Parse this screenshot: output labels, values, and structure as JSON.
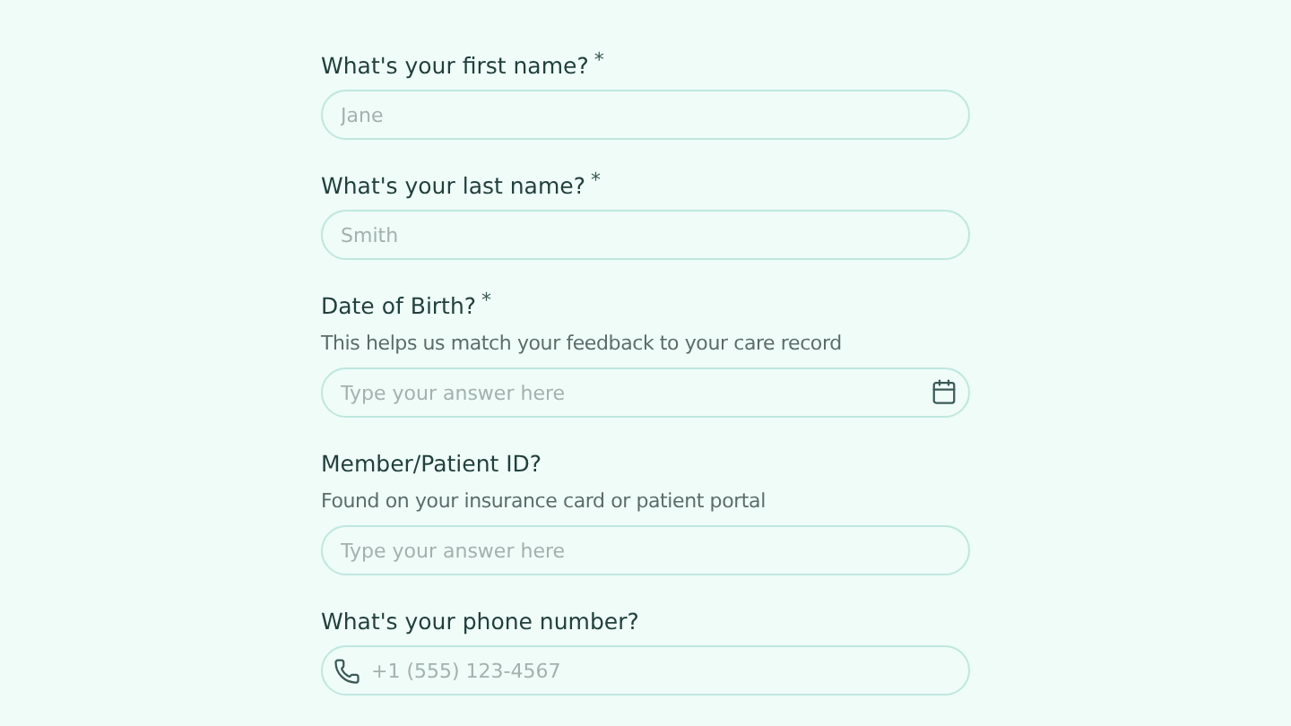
{
  "questions": [
    {
      "label": "What's your first name?",
      "required_mark": "*",
      "kind": "text",
      "placeholder": "Jane"
    },
    {
      "label": "What's your last name?",
      "required_mark": "*",
      "kind": "text",
      "placeholder": "Smith"
    },
    {
      "label": "Date of Birth?",
      "required_mark": "*",
      "hint": "This helps us match your feedback to your care record",
      "kind": "date",
      "placeholder": "Type your answer here"
    },
    {
      "label": "Member/Patient ID?",
      "hint": "Found on your insurance card or patient portal",
      "kind": "text",
      "placeholder": "Type your answer here"
    },
    {
      "label": "What's your phone number?",
      "kind": "phone",
      "placeholder": "+1 (555) 123-4567"
    }
  ]
}
